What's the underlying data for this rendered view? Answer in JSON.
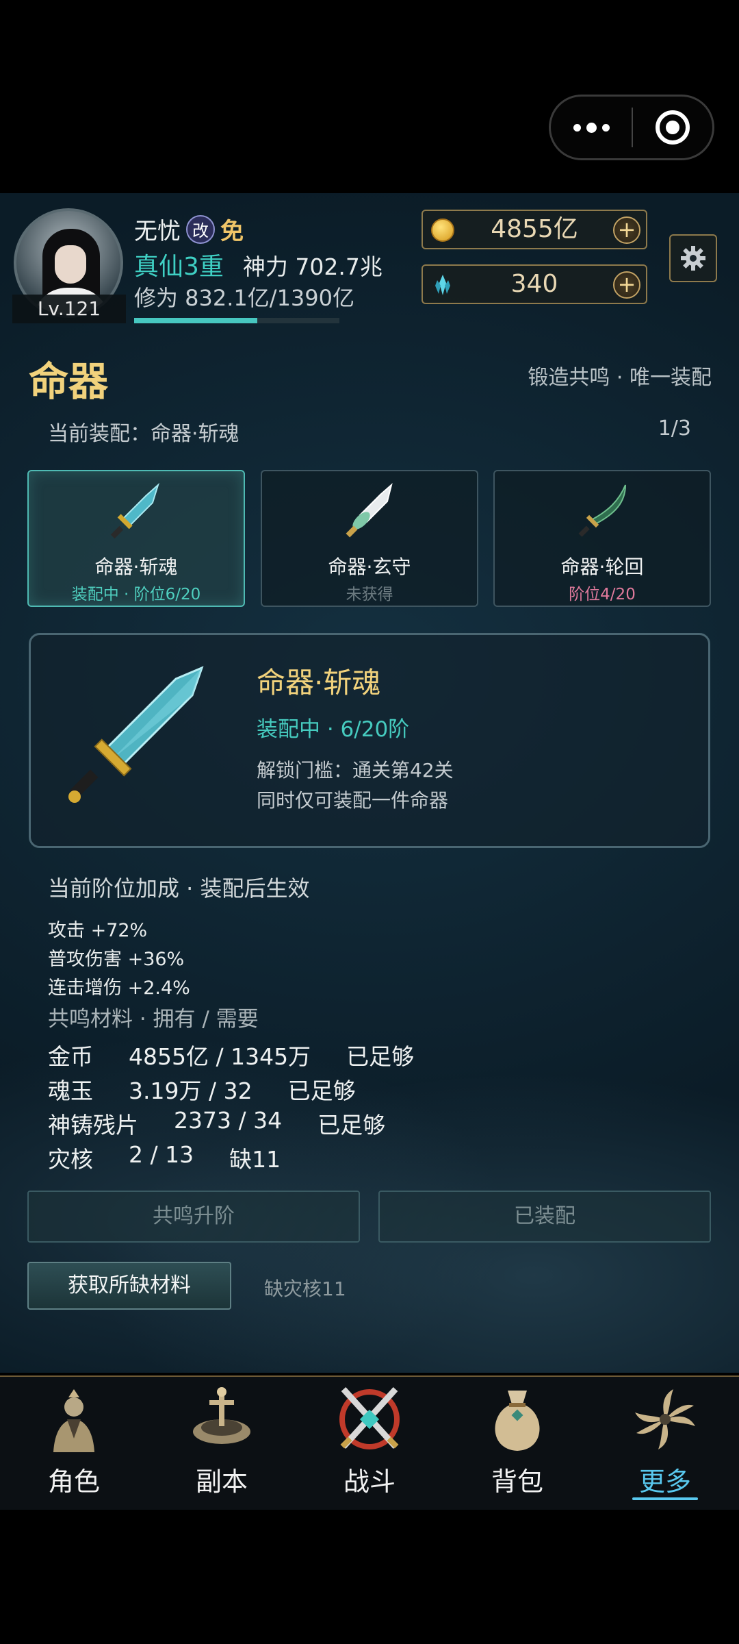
{
  "player": {
    "name": "无忧",
    "badge": "改",
    "tag": "免",
    "realm": "真仙3重",
    "power": "神力 702.7兆",
    "cultivation": "修为 832.1亿/1390亿",
    "cultivation_progress": 0.6,
    "level": "Lv.121"
  },
  "resources": {
    "gold": "4855亿",
    "gems": "340"
  },
  "section": {
    "title": "命器",
    "subtitle": "锻造共鸣 · 唯一装配",
    "current": "当前装配：命器·斩魂",
    "count": "1/3"
  },
  "weapons": [
    {
      "name": "命器·斩魂",
      "status": "装配中 · 阶位6/20",
      "status_color": "#4fcfbf"
    },
    {
      "name": "命器·玄守",
      "status": "未获得",
      "status_color": "#6b7a80"
    },
    {
      "name": "命器·轮回",
      "status": "阶位4/20",
      "status_color": "#e07a9c"
    }
  ],
  "detail": {
    "name": "命器·斩魂",
    "status": "装配中 · 6/20阶",
    "unlock": "解锁门槛：通关第42关",
    "note": "同时仅可装配一件命器"
  },
  "bonus": {
    "heading": "当前阶位加成 · 装配后生效",
    "lines": [
      "攻击 +72%",
      "普攻伤害 +36%",
      "连击增伤 +2.4%"
    ]
  },
  "materials": {
    "heading": "共鸣材料 · 拥有 / 需要",
    "rows": [
      {
        "name": "金币",
        "qty": "4855亿 / 1345万",
        "state": "已足够"
      },
      {
        "name": "魂玉",
        "qty": "3.19万 / 32",
        "state": "已足够"
      },
      {
        "name": "神铸残片",
        "qty": "2373 / 34",
        "state": "已足够"
      },
      {
        "name": "灾核",
        "qty": "2 / 13",
        "state": "缺11"
      }
    ]
  },
  "buttons": {
    "upgrade": "共鸣升阶",
    "equipped": "已装配",
    "get_materials": "获取所缺材料",
    "lacking": "缺灾核11"
  },
  "nav": [
    {
      "label": "角色",
      "icon": "character-icon"
    },
    {
      "label": "副本",
      "icon": "dungeon-icon"
    },
    {
      "label": "战斗",
      "icon": "battle-icon"
    },
    {
      "label": "背包",
      "icon": "bag-icon"
    },
    {
      "label": "更多",
      "icon": "more-icon",
      "active": true
    }
  ]
}
